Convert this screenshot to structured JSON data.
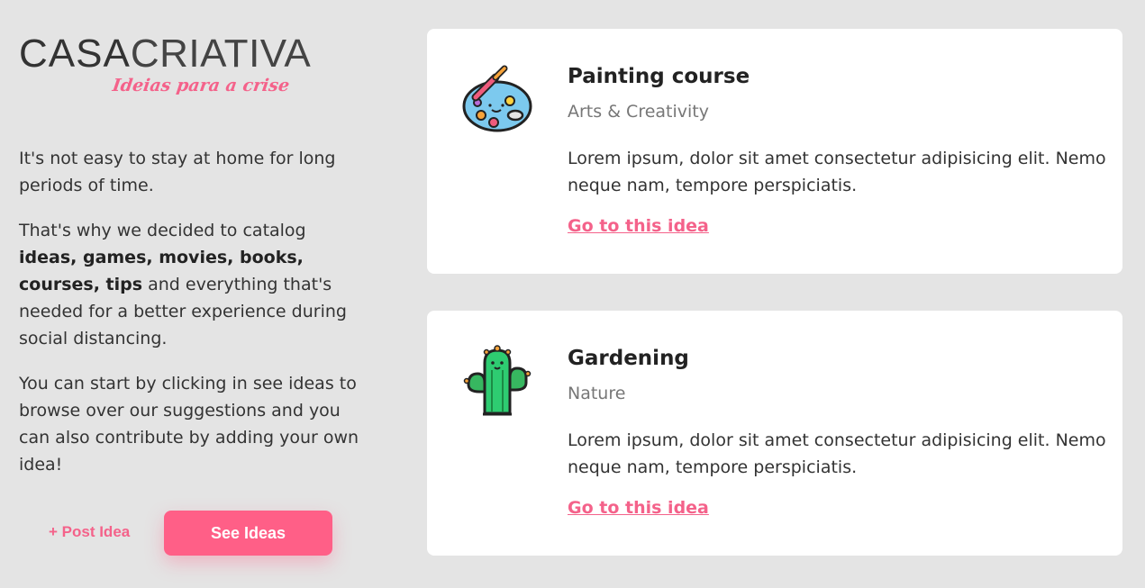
{
  "logo": {
    "brand_bold": "CASA",
    "brand_light": "CRIATIVA",
    "tagline": "Ideias para a crise"
  },
  "intro": {
    "p1": "It's not easy to stay at home for long periods of time.",
    "p2_before": "That's why we decided to catalog ",
    "p2_bold": "ideas, games, movies, books, courses, tips",
    "p2_after": " and everything that's needed for a better experience during social distancing.",
    "p3": "You can start by clicking in see ideas to browse over our suggestions and you can also contribute by adding your own idea!"
  },
  "actions": {
    "post_idea": "+ Post Idea",
    "see_ideas": "See Ideas"
  },
  "ideas": [
    {
      "icon": "paint-palette-icon",
      "title": "Painting course",
      "category": "Arts & Creativity",
      "description": "Lorem ipsum, dolor sit amet consectetur adipisicing elit. Nemo neque nam, tempore perspiciatis.",
      "link": "Go to this idea"
    },
    {
      "icon": "cactus-icon",
      "title": "Gardening",
      "category": "Nature",
      "description": "Lorem ipsum, dolor sit amet consectetur adipisicing elit. Nemo neque nam, tempore perspiciatis.",
      "link": "Go to this idea"
    }
  ],
  "colors": {
    "background": "#e4e4e4",
    "accent": "#ff5f87",
    "card": "#ffffff"
  }
}
